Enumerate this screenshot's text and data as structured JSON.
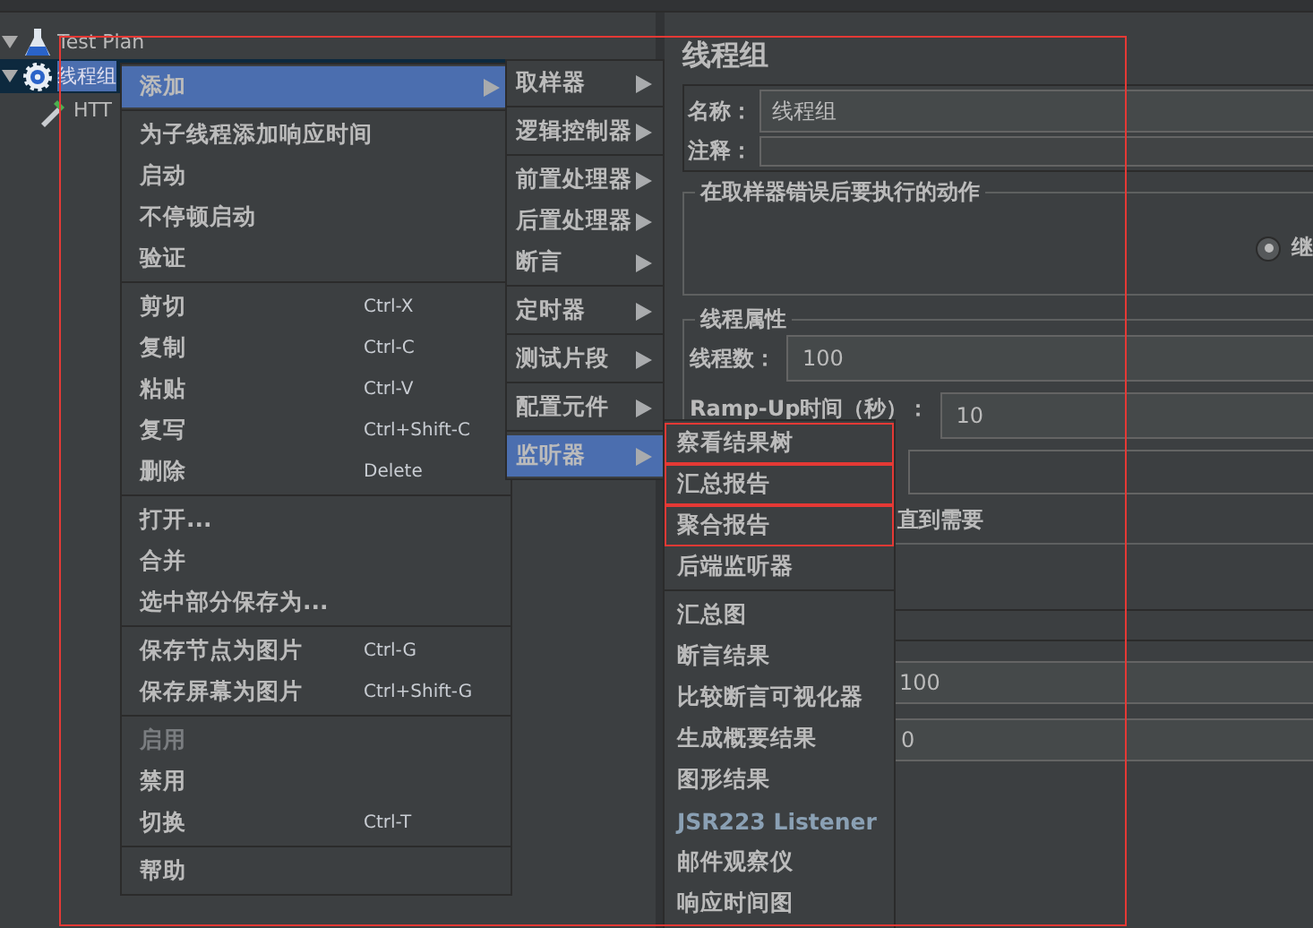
{
  "tree": [
    {
      "label": "Test Plan",
      "expanded": true,
      "selected": false
    },
    {
      "label": "线程组",
      "expanded": true,
      "selected": true
    },
    {
      "label": "HTT",
      "selected": false
    }
  ],
  "panel": {
    "title": "线程组",
    "name_label": "名称：",
    "name_value": "线程组",
    "comment_label": "注释：",
    "error_group": {
      "title": "在取样器错误后要执行的动作",
      "option": {
        "label": "继",
        "selected": true
      }
    },
    "props_group": {
      "title": "线程属性",
      "threads_label": "线程数：",
      "threads_value": "100",
      "rampup_label": "Ramp-Up时间（秒）：",
      "rampup_value": "10",
      "delay_text": "直到需要",
      "field_value_1": "100",
      "field_value_2": "0"
    }
  },
  "annotation_frame": true,
  "menus": [
    {
      "items": [
        {
          "kind": "item",
          "label": "添加",
          "submenu": true,
          "selected": true
        },
        {
          "kind": "separator"
        },
        {
          "kind": "item",
          "label": "为子线程添加响应时间",
          "selected": false
        },
        {
          "kind": "item",
          "label": "启动",
          "selected": false
        },
        {
          "kind": "item",
          "label": "不停顿启动",
          "selected": false
        },
        {
          "kind": "item",
          "label": "验证",
          "selected": false
        },
        {
          "kind": "separator"
        },
        {
          "kind": "item",
          "label": "剪切",
          "shortcut": "Ctrl-X",
          "selected": false
        },
        {
          "kind": "item",
          "label": "复制",
          "shortcut": "Ctrl-C",
          "selected": false
        },
        {
          "kind": "item",
          "label": "粘贴",
          "shortcut": "Ctrl-V",
          "selected": false
        },
        {
          "kind": "item",
          "label": "复写",
          "shortcut": "Ctrl+Shift-C",
          "selected": false
        },
        {
          "kind": "item",
          "label": "删除",
          "shortcut": "Delete",
          "selected": false
        },
        {
          "kind": "separator"
        },
        {
          "kind": "item",
          "label": "打开...",
          "selected": false
        },
        {
          "kind": "item",
          "label": "合并",
          "selected": false
        },
        {
          "kind": "item",
          "label": "选中部分保存为...",
          "selected": false
        },
        {
          "kind": "separator"
        },
        {
          "kind": "item",
          "label": "保存节点为图片",
          "shortcut": "Ctrl-G",
          "selected": false
        },
        {
          "kind": "item",
          "label": "保存屏幕为图片",
          "shortcut": "Ctrl+Shift-G",
          "selected": false
        },
        {
          "kind": "separator"
        },
        {
          "kind": "item",
          "label": "启用",
          "disabled": true,
          "selected": false
        },
        {
          "kind": "item",
          "label": "禁用",
          "selected": false
        },
        {
          "kind": "item",
          "label": "切换",
          "shortcut": "Ctrl-T",
          "selected": false
        },
        {
          "kind": "separator"
        },
        {
          "kind": "item",
          "label": "帮助",
          "selected": false
        }
      ]
    },
    {
      "items": [
        {
          "kind": "item",
          "label": "取样器",
          "submenu": true,
          "selected": false
        },
        {
          "kind": "separator"
        },
        {
          "kind": "item",
          "label": "逻辑控制器",
          "submenu": true,
          "selected": false
        },
        {
          "kind": "separator"
        },
        {
          "kind": "item",
          "label": "前置处理器",
          "submenu": true,
          "selected": false
        },
        {
          "kind": "item",
          "label": "后置处理器",
          "submenu": true,
          "selected": false
        },
        {
          "kind": "item",
          "label": "断言",
          "submenu": true,
          "selected": false
        },
        {
          "kind": "separator"
        },
        {
          "kind": "item",
          "label": "定时器",
          "submenu": true,
          "selected": false
        },
        {
          "kind": "separator"
        },
        {
          "kind": "item",
          "label": "测试片段",
          "submenu": true,
          "selected": false
        },
        {
          "kind": "separator"
        },
        {
          "kind": "item",
          "label": "配置元件",
          "submenu": true,
          "selected": false
        },
        {
          "kind": "separator"
        },
        {
          "kind": "item",
          "label": "监听器",
          "submenu": true,
          "selected": true
        }
      ]
    },
    {
      "items": [
        {
          "kind": "item",
          "label": "察看结果树",
          "annotated": true,
          "selected": false
        },
        {
          "kind": "item",
          "label": "汇总报告",
          "annotated": true,
          "selected": false
        },
        {
          "kind": "item",
          "label": "聚合报告",
          "annotated": true,
          "selected": false
        },
        {
          "kind": "item",
          "label": "后端监听器",
          "selected": false
        },
        {
          "kind": "separator"
        },
        {
          "kind": "item",
          "label": "汇总图",
          "selected": false
        },
        {
          "kind": "item",
          "label": "断言结果",
          "selected": false
        },
        {
          "kind": "item",
          "label": "比较断言可视化器",
          "selected": false
        },
        {
          "kind": "item",
          "label": "生成概要结果",
          "selected": false
        },
        {
          "kind": "item",
          "label": "图形结果",
          "selected": false
        },
        {
          "kind": "item",
          "label": "JSR223 Listener",
          "latin": true,
          "selected": false
        },
        {
          "kind": "item",
          "label": "邮件观察仪",
          "selected": false
        },
        {
          "kind": "item",
          "label": "响应时间图",
          "selected": false
        }
      ]
    }
  ]
}
